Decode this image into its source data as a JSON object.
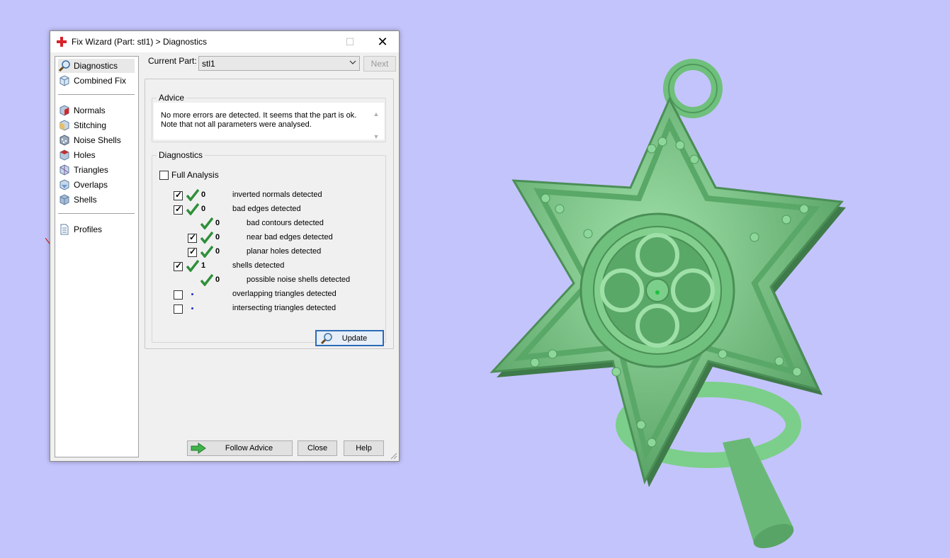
{
  "window": {
    "title": "Fix Wizard (Part: stl1) > Diagnostics",
    "minimize_glyph": "—",
    "maximize_glyph": "☐",
    "close_glyph": "✕"
  },
  "nav": {
    "items": [
      {
        "label": "Diagnostics",
        "icon": "magnifier-icon"
      },
      {
        "label": "Combined Fix",
        "icon": "cube-icon"
      },
      {
        "label": "Normals",
        "icon": "normals-cube-icon"
      },
      {
        "label": "Stitching",
        "icon": "stitching-cube-icon"
      },
      {
        "label": "Noise Shells",
        "icon": "noise-shells-icon"
      },
      {
        "label": "Holes",
        "icon": "holes-cube-icon"
      },
      {
        "label": "Triangles",
        "icon": "triangles-cube-icon"
      },
      {
        "label": "Overlaps",
        "icon": "overlaps-cube-icon"
      },
      {
        "label": "Shells",
        "icon": "shells-cube-icon"
      },
      {
        "label": "Profiles",
        "icon": "document-icon"
      }
    ]
  },
  "current_part": {
    "label": "Current Part:",
    "value": "stl1",
    "next_label": "Next"
  },
  "advice": {
    "title": "Advice",
    "text": "No more errors are detected. It seems that the part is ok.\nNote that not all parameters were analysed."
  },
  "diagnostics": {
    "title": "Diagnostics",
    "full_analysis_label": "Full Analysis",
    "rows": [
      {
        "count": "0",
        "label": "inverted normals detected"
      },
      {
        "count": "0",
        "label": "bad edges detected"
      },
      {
        "count": "0",
        "label": "bad contours detected"
      },
      {
        "count": "0",
        "label": "near bad edges detected"
      },
      {
        "count": "0",
        "label": "planar holes detected"
      },
      {
        "count": "1",
        "label": "shells detected"
      },
      {
        "count": "0",
        "label": "possible noise shells detected"
      },
      {
        "count": "",
        "label": "overlapping triangles detected"
      },
      {
        "count": "",
        "label": "intersecting triangles detected"
      }
    ],
    "update_label": "Update"
  },
  "buttons": {
    "follow_advice": "Follow Advice",
    "close": "Close",
    "help": "Help"
  },
  "colors": {
    "background": "#c4c4fc",
    "model": "#7ccf8a",
    "check_green": "#2f8f3a",
    "accent_blue": "#2b6cb7"
  }
}
